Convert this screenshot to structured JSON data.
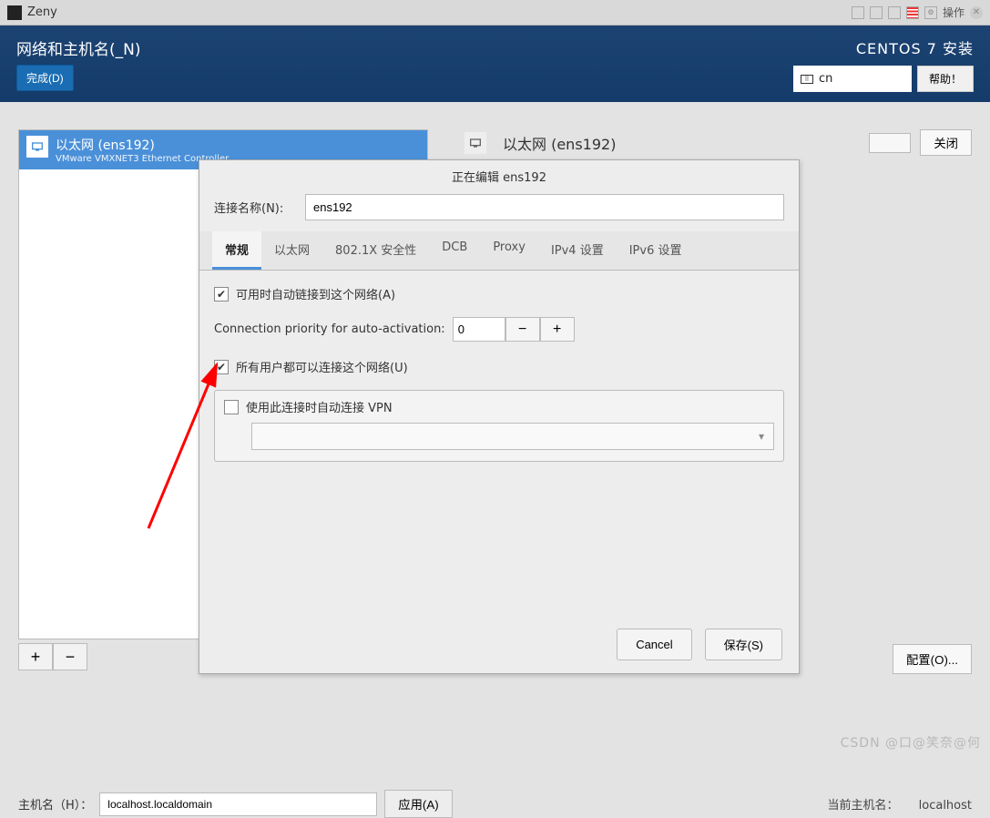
{
  "titlebar": {
    "title": "Zeny",
    "ops": "操作"
  },
  "header": {
    "title": "网络和主机名(_N)",
    "done": "完成(D)",
    "installer": "CENTOS 7 安装",
    "lang": "cn",
    "help": "帮助！"
  },
  "netlist": {
    "item_title": "以太网 (ens192)",
    "item_sub": "VMware VMXNET3 Ethernet Controller",
    "plus": "+",
    "minus": "−"
  },
  "detail": {
    "title": "以太网 (ens192)",
    "close": "关闭",
    "config": "配置(O)..."
  },
  "hostname": {
    "label": "主机名（H）：",
    "value": "localhost.localdomain",
    "apply": "应用(A)",
    "cur_label": "当前主机名：",
    "cur_val": "localhost"
  },
  "dialog": {
    "title": "正在编辑 ens192",
    "conn_label": "连接名称(N):",
    "conn_value": "ens192",
    "tabs": [
      "常规",
      "以太网",
      "802.1X 安全性",
      "DCB",
      "Proxy",
      "IPv4 设置",
      "IPv6 设置"
    ],
    "check1": "可用时自动链接到这个网络(A)",
    "prio_label": "Connection priority for auto-activation:",
    "prio_value": "0",
    "check2": "所有用户都可以连接这个网络(U)",
    "check3": "使用此连接时自动连接 VPN",
    "cancel": "Cancel",
    "save": "保存(S)"
  },
  "watermark": "CSDN @口@笑奈@何"
}
